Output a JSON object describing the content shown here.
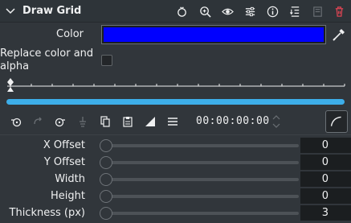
{
  "header": {
    "title": "Draw Grid",
    "icons": [
      "reset-icon",
      "zoom-icon",
      "visibility-icon",
      "presets-icon",
      "info-icon",
      "collapse-all-icon",
      "save-icon",
      "delete-icon"
    ]
  },
  "color_param": {
    "label": "Color",
    "value": "#0000ff"
  },
  "replace_param": {
    "label_line1": "Replace color and",
    "label_line2": "alpha",
    "checked": false
  },
  "timeline": {
    "progress_percent": 100
  },
  "keyframe_toolbar": {
    "timecode": "00:00:00:00"
  },
  "params": [
    {
      "label": "X Offset",
      "value": "0"
    },
    {
      "label": "Y Offset",
      "value": "0"
    },
    {
      "label": "Width",
      "value": "0"
    },
    {
      "label": "Height",
      "value": "0"
    },
    {
      "label": "Thickness (px)",
      "value": "3"
    }
  ],
  "colors": {
    "accent": "#3daee9",
    "background": "#31363b",
    "delete_red": "#da4453"
  }
}
